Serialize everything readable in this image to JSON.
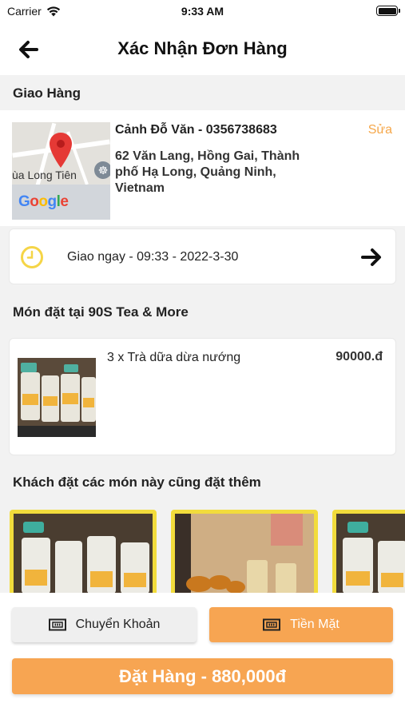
{
  "status_bar": {
    "carrier": "Carrier",
    "time": "9:33 AM",
    "battery_level": 1.0
  },
  "header": {
    "title": "Xác Nhận Đơn Hàng",
    "back_icon": "arrow-left-icon"
  },
  "delivery": {
    "section_title": "Giao Hàng",
    "map": {
      "label": "ùa Long Tiên",
      "logo": "Google",
      "pin_icon": "map-pin-icon"
    },
    "recipient": "Cảnh Đỗ Văn - 0356738683",
    "edit_label": "Sửa",
    "address": "62 Văn Lang, Hồng Gai, Thành phố Hạ Long, Quảng Ninh, Vietnam",
    "time": {
      "label": "Giao ngay - 09:33 - 2022-3-30",
      "icon": "clock-icon",
      "action_icon": "arrow-right-icon"
    }
  },
  "order": {
    "section_title": "Món đặt tại 90S Tea & More",
    "items": [
      {
        "name": "3 x Trà dữa dừa nướng",
        "price": "90000.đ"
      }
    ]
  },
  "suggestions": {
    "section_title": "Khách đặt các món này cũng đặt thêm",
    "count": 3
  },
  "payment": {
    "options": [
      {
        "label": "Chuyển Khoản",
        "selected": false,
        "icon": "cash-icon"
      },
      {
        "label": "Tiền Mặt",
        "selected": true,
        "icon": "cash-icon"
      }
    ],
    "order_button": "Đặt Hàng - 880,000đ"
  },
  "colors": {
    "accent": "#f7a552",
    "highlight": "#f2dc3c",
    "clock": "#f5d547"
  }
}
